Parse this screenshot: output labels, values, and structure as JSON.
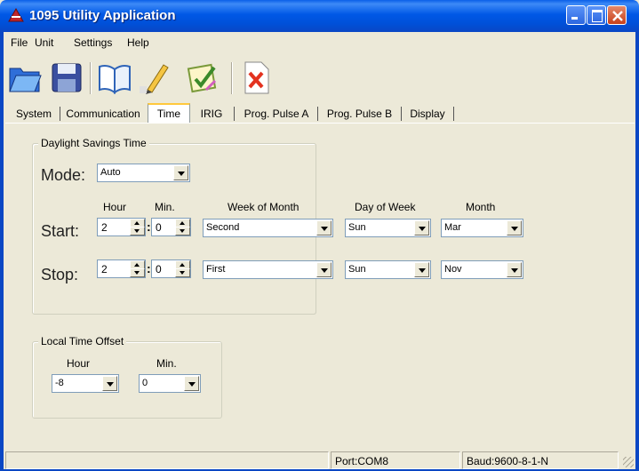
{
  "window": {
    "title": "1095 Utility Application"
  },
  "menu": [
    "File",
    "Unit",
    "Settings",
    "Help"
  ],
  "toolbar": {
    "icons": [
      "open-folder-icon",
      "save-disk-icon",
      "open-book-icon",
      "pencil-icon",
      "checklist-icon",
      "delete-x-icon"
    ]
  },
  "tabs": [
    "System",
    "Communication",
    "Time",
    "IRIG",
    "Prog. Pulse A",
    "Prog. Pulse B",
    "Display"
  ],
  "active_tab": "Time",
  "dst": {
    "legend": "Daylight Savings Time",
    "mode_label": "Mode:",
    "mode_value": "Auto",
    "headers": {
      "hour": "Hour",
      "min": "Min.",
      "week": "Week of Month",
      "day": "Day of Week",
      "month": "Month"
    },
    "start": {
      "label": "Start:",
      "hour": "2",
      "min": "0",
      "week": "Second",
      "day": "Sun",
      "month": "Mar"
    },
    "stop": {
      "label": "Stop:",
      "hour": "2",
      "min": "0",
      "week": "First",
      "day": "Sun",
      "month": "Nov"
    },
    "colon": ":"
  },
  "offset": {
    "legend": "Local Time Offset",
    "hour_label": "Hour",
    "min_label": "Min.",
    "hour_value": "-8",
    "min_value": "0"
  },
  "status": {
    "port": "Port:COM8",
    "baud": "Baud:9600-8-1-N"
  },
  "colors": {
    "titlebar": "#0054e3",
    "face": "#ece9d8",
    "active_tab_accent": "#ffc83c"
  }
}
